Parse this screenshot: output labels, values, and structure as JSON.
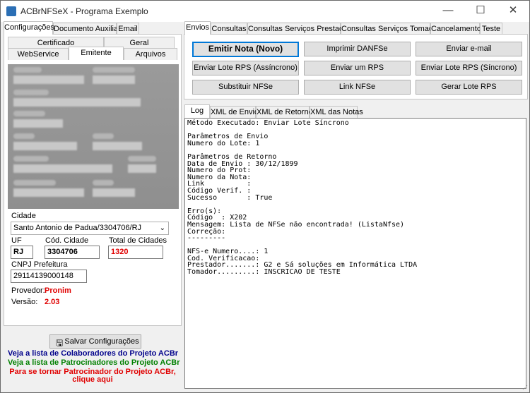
{
  "window": {
    "title": "ACBrNFSeX - Programa Exemplo",
    "minimize": "—",
    "maximize": "☐",
    "close": "✕"
  },
  "left_tabs": [
    "Configurações",
    "Documento Auxiliar",
    "Email"
  ],
  "sub_tabs_row1": [
    "Certificado",
    "Geral"
  ],
  "sub_tabs_row2": [
    "WebService",
    "Emitente",
    "Arquivos"
  ],
  "emitente": {
    "cidade_label": "Cidade",
    "cidade_value": "Santo Antonio de Padua/3304706/RJ",
    "uf_label": "UF",
    "uf_value": "RJ",
    "cod_cidade_label": "Cód. Cidade",
    "cod_cidade_value": "3304706",
    "total_label": "Total de Cidades",
    "total_value": "1320",
    "cnpj_label": "CNPJ Prefeitura",
    "cnpj_value": "29114139000148",
    "provedor_label": "Provedor:",
    "provedor_value": "Pronim",
    "versao_label": "Versão:",
    "versao_value": "2.03"
  },
  "save_button": "Salvar Configurações",
  "links": {
    "colaboradores": "Veja a lista de Colaboradores do Projeto ACBr",
    "patrocinadores": "Veja a lista de Patrocinadores do Projeto ACBr",
    "patrocinar_1": "Para se tornar Patrocinador do Projeto ACBr,",
    "patrocinar_2": "clique aqui"
  },
  "right_tabs": [
    "Envios",
    "Consultas",
    "Consultas Serviços Prestados",
    "Consultas Serviços Tomados",
    "Cancelamento",
    "Teste"
  ],
  "buttons": {
    "emitir": "Emitir Nota (Novo)",
    "imprimir": "Imprimir DANFSe",
    "email": "Enviar e-mail",
    "lote_async": "Enviar Lote RPS (Assíncrono)",
    "um_rps": "Enviar um RPS",
    "lote_sync": "Enviar Lote RPS (Síncrono)",
    "substituir": "Substituir NFSe",
    "link": "Link NFSe",
    "gerar": "Gerar Lote RPS"
  },
  "log_tabs": [
    "Log",
    "XML de Envio",
    "XML de Retorno",
    "XML das Notas"
  ],
  "log_text": "Método Executado: Enviar Lote Síncrono\n\nParâmetros de Envio\nNumero do Lote: 1\n\nParâmetros de Retorno\nData de Envio : 30/12/1899\nNumero do Prot:\nNumero da Nota:\nLink          :\nCódigo Verif. :\nSucesso       : True\n\nErro(s):\nCódigo  : X202\nMensagem: Lista de NFSe não encontrada! (ListaNfse)\nCorreção:\n---------\n\nNFS-e Numero....: 1\nCod. Verificacao:\nPrestador.......: G2 e Sá soluções em Informática LTDA\nTomador.........: INSCRICAO DE TESTE",
  "colors": {
    "accent": "#0078d7",
    "red": "#e00000",
    "blue_link": "#00008b",
    "green_link": "#008000"
  }
}
